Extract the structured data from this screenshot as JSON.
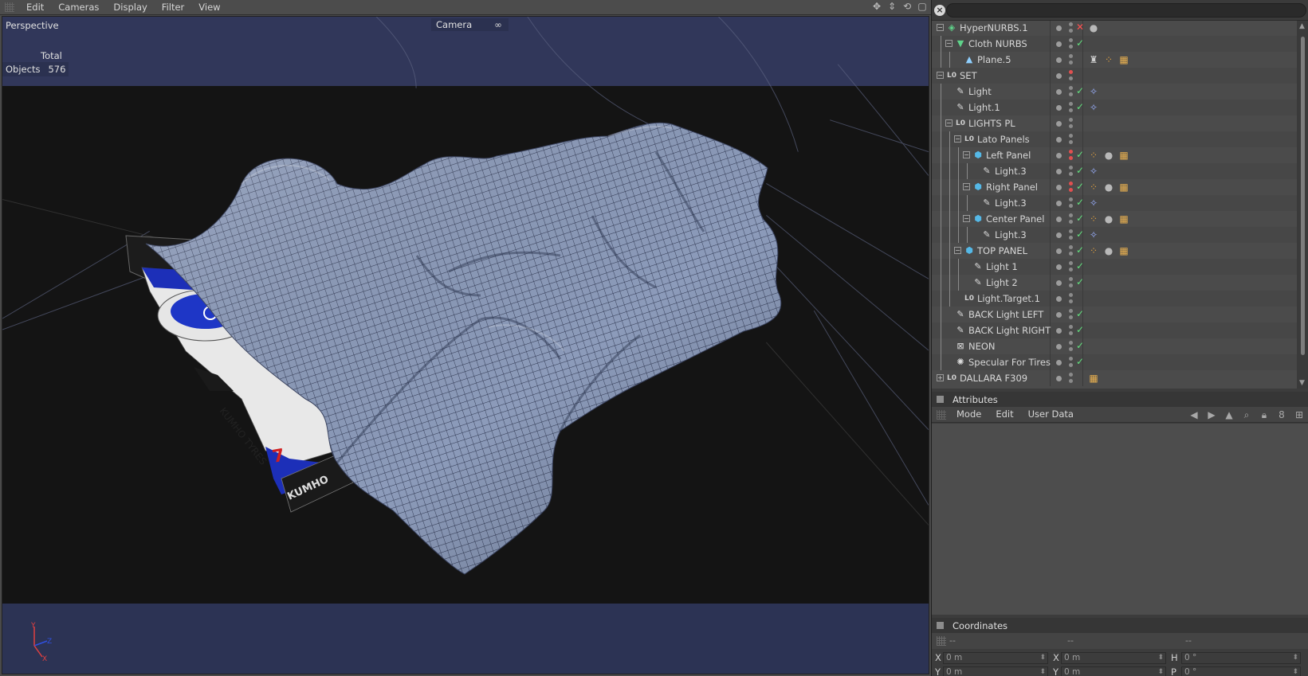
{
  "viewport": {
    "menu": [
      "Edit",
      "Cameras",
      "Display",
      "Filter",
      "View"
    ],
    "view_name": "Perspective",
    "camera_label": "Camera",
    "camera_value": "∞",
    "hud_total": "Total",
    "hud_objects_label": "Objects",
    "hud_objects_value": "576",
    "nav_icons": [
      "move-icon",
      "dolly-icon",
      "rotate-icon",
      "maximize-icon"
    ],
    "axis_labels": {
      "y": "Y",
      "z": "Z",
      "x": "X"
    },
    "car_livery_text": [
      "KUMHO TYRES",
      "KUMHO",
      "7"
    ]
  },
  "object_manager": {
    "search_placeholder": "",
    "objects": [
      {
        "name": "HyperNURBS.1",
        "icon": "hypernurbs-icon",
        "glyph": "◈",
        "color": "#5fd38a",
        "expand": "−",
        "check": "x",
        "tags": [
          "●"
        ]
      },
      {
        "name": "Cloth NURBS",
        "icon": "cloth-nurbs-icon",
        "glyph": "▼",
        "color": "#5fd38a",
        "expand": "−",
        "check": "✓",
        "tags": []
      },
      {
        "name": "Plane.5",
        "icon": "plane-icon",
        "glyph": "▲",
        "color": "#8fd0ff",
        "expand": "",
        "check": "",
        "tags": [
          "♜",
          "⁘",
          "▦"
        ]
      },
      {
        "name": "SET",
        "icon": "null-icon",
        "glyph": "L0",
        "color": "#cfcfcf",
        "expand": "−",
        "check": "",
        "tags": []
      },
      {
        "name": "Light",
        "icon": "light-icon",
        "glyph": "✎",
        "color": "#dcdcdc",
        "expand": "",
        "check": "✓",
        "tags": [
          "✧"
        ]
      },
      {
        "name": "Light.1",
        "icon": "light-icon",
        "glyph": "✎",
        "color": "#dcdcdc",
        "expand": "",
        "check": "✓",
        "tags": [
          "✧"
        ]
      },
      {
        "name": "LIGHTS PL",
        "icon": "null-icon",
        "glyph": "L0",
        "color": "#cfcfcf",
        "expand": "−",
        "check": "",
        "tags": []
      },
      {
        "name": "Lato Panels",
        "icon": "null-icon",
        "glyph": "L0",
        "color": "#cfcfcf",
        "expand": "−",
        "check": "",
        "tags": []
      },
      {
        "name": "Left Panel",
        "icon": "cube-icon",
        "glyph": "⬢",
        "color": "#55b8e6",
        "expand": "−",
        "check": "✓",
        "tags": [
          "⁘",
          "●",
          "▦"
        ]
      },
      {
        "name": "Light.3",
        "icon": "light-icon",
        "glyph": "✎",
        "color": "#dcdcdc",
        "expand": "",
        "check": "✓",
        "tags": [
          "✧"
        ]
      },
      {
        "name": "Right Panel",
        "icon": "cube-icon",
        "glyph": "⬢",
        "color": "#55b8e6",
        "expand": "−",
        "check": "✓",
        "tags": [
          "⁘",
          "●",
          "▦"
        ]
      },
      {
        "name": "Light.3",
        "icon": "light-icon",
        "glyph": "✎",
        "color": "#dcdcdc",
        "expand": "",
        "check": "✓",
        "tags": [
          "✧"
        ]
      },
      {
        "name": "Center Panel",
        "icon": "cube-icon",
        "glyph": "⬢",
        "color": "#55b8e6",
        "expand": "−",
        "check": "✓",
        "tags": [
          "⁘",
          "●",
          "▦"
        ]
      },
      {
        "name": "Light.3",
        "icon": "light-icon",
        "glyph": "✎",
        "color": "#dcdcdc",
        "expand": "",
        "check": "✓",
        "tags": [
          "✧"
        ]
      },
      {
        "name": "TOP PANEL",
        "icon": "cube-icon",
        "glyph": "⬢",
        "color": "#55b8e6",
        "expand": "−",
        "check": "✓",
        "tags": [
          "⁘",
          "●",
          "▦"
        ]
      },
      {
        "name": "Light 1",
        "icon": "light-icon",
        "glyph": "✎",
        "color": "#dcdcdc",
        "expand": "",
        "check": "✓",
        "tags": []
      },
      {
        "name": "Light 2",
        "icon": "light-icon",
        "glyph": "✎",
        "color": "#dcdcdc",
        "expand": "",
        "check": "✓",
        "tags": []
      },
      {
        "name": "Light.Target.1",
        "icon": "null-icon",
        "glyph": "L0",
        "color": "#cfcfcf",
        "expand": "",
        "check": "",
        "tags": []
      },
      {
        "name": "BACK Light LEFT",
        "icon": "light-icon",
        "glyph": "✎",
        "color": "#dcdcdc",
        "expand": "",
        "check": "✓",
        "tags": []
      },
      {
        "name": "BACK Light RIGHT",
        "icon": "light-icon",
        "glyph": "✎",
        "color": "#dcdcdc",
        "expand": "",
        "check": "✓",
        "tags": []
      },
      {
        "name": "NEON",
        "icon": "neon-icon",
        "glyph": "⊠",
        "color": "#dcdcdc",
        "expand": "",
        "check": "✓",
        "tags": []
      },
      {
        "name": "Specular For Tires",
        "icon": "specular-icon",
        "glyph": "✺",
        "color": "#dcdcdc",
        "expand": "",
        "check": "✓",
        "tags": []
      },
      {
        "name": "DALLARA F309",
        "icon": "null-icon",
        "glyph": "L0",
        "color": "#cfcfcf",
        "expand": "+",
        "check": "",
        "tags": [
          "▦"
        ]
      }
    ]
  },
  "attributes": {
    "title": "Attributes",
    "menu": [
      "Mode",
      "Edit",
      "User Data"
    ],
    "tools": [
      "◀",
      "▶",
      "▲",
      "🔍",
      "🔒",
      "8",
      "⊞"
    ]
  },
  "coordinates": {
    "title": "Coordinates",
    "subbar": [
      "--",
      "--",
      "--"
    ],
    "rows": [
      {
        "l1": "X",
        "v1": "0 m",
        "l2": "X",
        "v2": "0 m",
        "l3": "H",
        "v3": "0 °"
      },
      {
        "l1": "Y",
        "v1": "0 m",
        "l2": "Y",
        "v2": "0 m",
        "l3": "P",
        "v3": "0 °"
      }
    ]
  },
  "colors": {
    "sky": "#31375a",
    "floor": "#2c3354",
    "background": "#141414",
    "cloth": "#8b9ab8",
    "check_green": "#62e07e",
    "x_red": "#ff5050"
  }
}
